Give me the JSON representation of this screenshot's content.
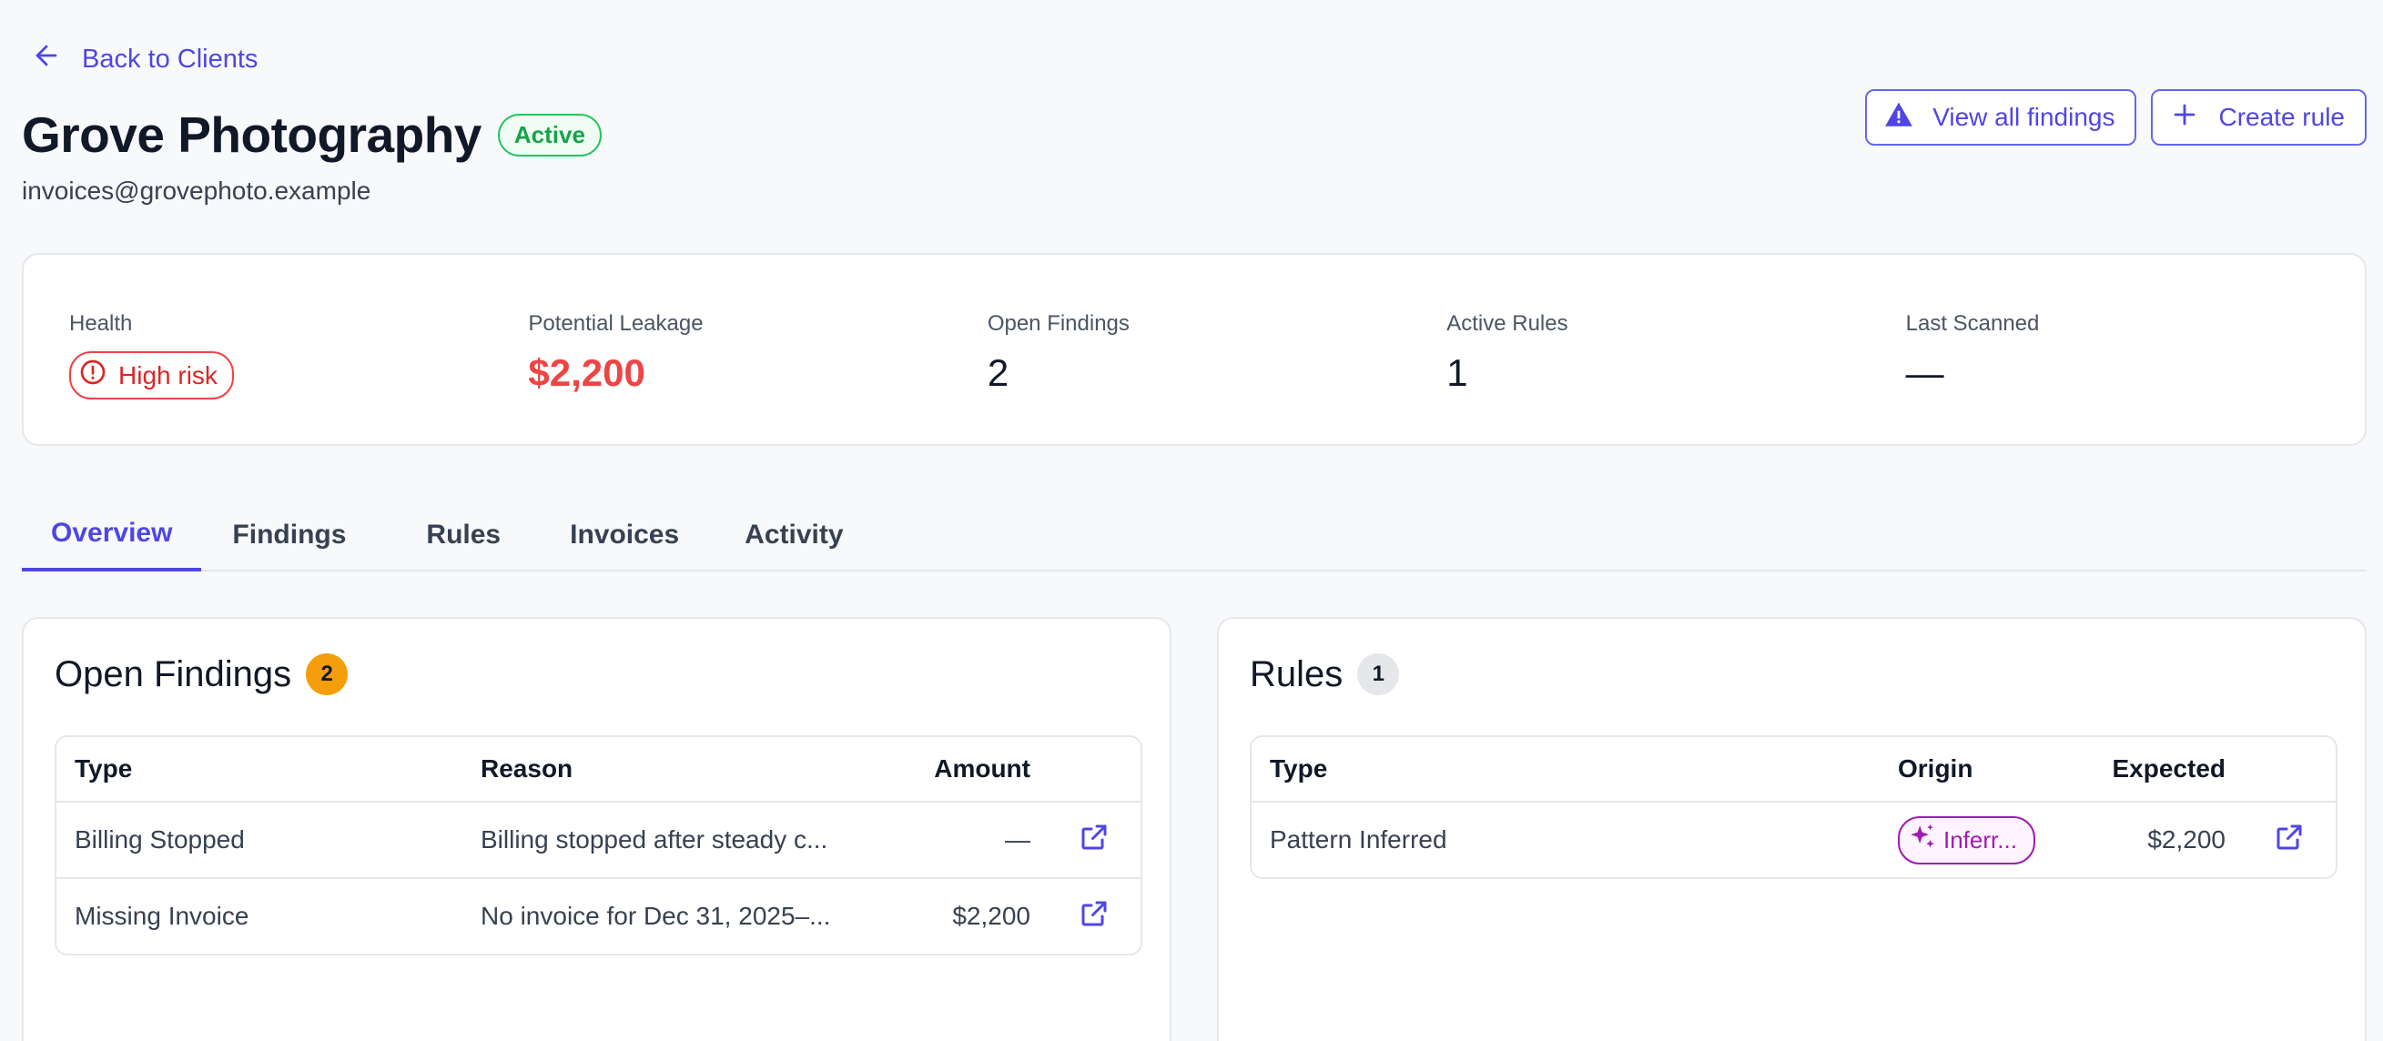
{
  "nav": {
    "back_label": "Back to Clients"
  },
  "client": {
    "name": "Grove Photography",
    "status": "Active",
    "email": "invoices@grovephoto.example"
  },
  "actions": {
    "view_findings": "View all findings",
    "create_rule": "Create rule"
  },
  "stats": {
    "health_label": "Health",
    "health_value": "High risk",
    "leakage_label": "Potential Leakage",
    "leakage_value": "$2,200",
    "open_findings_label": "Open Findings",
    "open_findings_value": "2",
    "active_rules_label": "Active Rules",
    "active_rules_value": "1",
    "last_scanned_label": "Last Scanned",
    "last_scanned_value": "—"
  },
  "tabs": [
    {
      "label": "Overview",
      "active": true
    },
    {
      "label": "Findings"
    },
    {
      "label": "Rules"
    },
    {
      "label": "Invoices"
    },
    {
      "label": "Activity"
    }
  ],
  "findings": {
    "title": "Open Findings",
    "count": "2",
    "columns": {
      "type": "Type",
      "reason": "Reason",
      "amount": "Amount"
    },
    "rows": [
      {
        "type": "Billing Stopped",
        "reason": "Billing stopped after steady c...",
        "amount": "—"
      },
      {
        "type": "Missing Invoice",
        "reason": "No invoice for Dec 31, 2025–...",
        "amount": "$2,200"
      }
    ]
  },
  "rules": {
    "title": "Rules",
    "count": "1",
    "columns": {
      "type": "Type",
      "origin": "Origin",
      "expected": "Expected"
    },
    "rows": [
      {
        "type": "Pattern Inferred",
        "origin": "Inferr...",
        "expected": "$2,200"
      }
    ]
  },
  "colors": {
    "accent": "#4f46e5",
    "success": "#22c55e",
    "danger": "#ef4444",
    "warning": "#f59e0b",
    "origin": "#a21caf"
  },
  "icons": {
    "back": "arrow-left-icon",
    "findings": "warning-triangle-icon",
    "create": "plus-icon",
    "risk": "alert-circle-icon",
    "open": "external-link-icon",
    "origin": "sparkles-icon"
  }
}
